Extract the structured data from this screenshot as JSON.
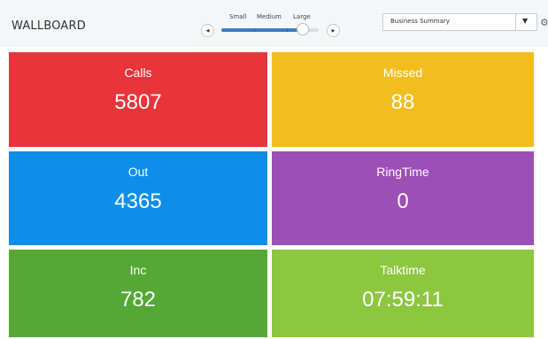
{
  "header": {
    "title": "WALLBOARD",
    "size_labels": [
      "Small",
      "Medium",
      "Large"
    ],
    "prev_icon": "left-arrow-icon",
    "next_icon": "right-arrow-icon",
    "slider_value": "Large",
    "dropdown_selected": "Business Summary",
    "dropdown_icon": "caret-down-icon",
    "settings_icon": "gear-icon"
  },
  "tiles": [
    {
      "label": "Calls",
      "value": "5807",
      "color": "#e9343a"
    },
    {
      "label": "Missed",
      "value": "88",
      "color": "#f3bd1e"
    },
    {
      "label": "Out",
      "value": "4365",
      "color": "#0d8ee9"
    },
    {
      "label": "RingTime",
      "value": "0",
      "color": "#9c4fb6"
    },
    {
      "label": "Inc",
      "value": "782",
      "color": "#54a833"
    },
    {
      "label": "Talktime",
      "value": "07:59:11",
      "color": "#8dc63f"
    }
  ]
}
